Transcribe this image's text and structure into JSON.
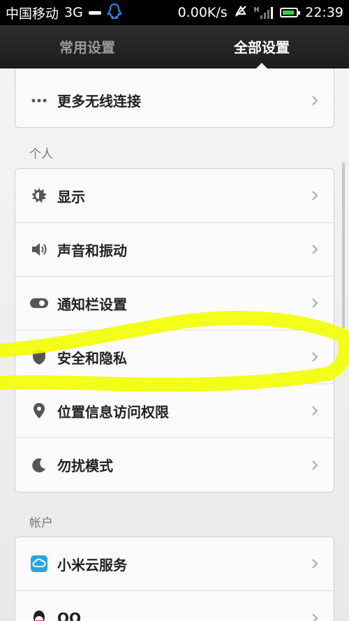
{
  "status": {
    "carrier": "中国移动",
    "network": "3G",
    "speed": "0.00K/s",
    "signal_h": "H",
    "time": "22:39"
  },
  "tabs": [
    {
      "label": "常用设置",
      "active": false
    },
    {
      "label": "全部设置",
      "active": true
    }
  ],
  "top_card": {
    "label": "更多无线连接",
    "icon": "more-dots-icon"
  },
  "personal": {
    "title": "个人",
    "items": [
      {
        "label": "显示",
        "icon": "brightness-icon"
      },
      {
        "label": "声音和振动",
        "icon": "speaker-icon"
      },
      {
        "label": "通知栏设置",
        "icon": "toggle-icon"
      },
      {
        "label": "安全和隐私",
        "icon": "shield-icon"
      },
      {
        "label": "位置信息访问权限",
        "icon": "location-pin-icon"
      },
      {
        "label": "勿扰模式",
        "icon": "moon-icon"
      }
    ]
  },
  "account": {
    "title": "帐户",
    "items": [
      {
        "label": "小米云服务",
        "icon": "cloud-icon"
      },
      {
        "label": "QQ",
        "icon": "qq-icon"
      }
    ]
  },
  "colors": {
    "highlight": "#f2ff00",
    "battery": "#39d14a",
    "cloud": "#2aa4e6"
  }
}
